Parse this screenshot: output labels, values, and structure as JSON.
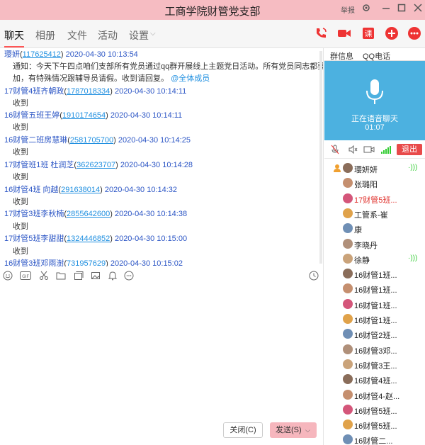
{
  "window": {
    "title": "工商学院财管党支部",
    "report_label": "举报",
    "controls": [
      "settings-icon",
      "minimize-icon",
      "maximize-icon",
      "close-icon"
    ]
  },
  "tabs": {
    "items": [
      "聊天",
      "相册",
      "文件",
      "活动",
      "设置"
    ],
    "active": "聊天"
  },
  "top_actions": [
    "voice-call-icon",
    "video-call-icon",
    "class-icon",
    "add-icon",
    "more-icon"
  ],
  "colors": {
    "title_bg": "#f6bcc2",
    "accent": "#f55555",
    "voice_panel": "#4cb1e0",
    "sender": "#2b55c5",
    "link": "#1f8fe0",
    "exit_red": "#e84a4a"
  },
  "messages": [
    {
      "sender": "璎妍",
      "qq": "117625412",
      "time": "2020-04-30 10:13:54",
      "body": "通知：今天下午四点咱们支部所有党员通过qq群开展线上主题党日活动。所有党员同志都要上线参",
      "body2": "加，有特殊情况跟辅导员请假。收到请回复。",
      "at": "@全体成员"
    },
    {
      "sender": "17财管4班齐朝政",
      "qq": "1787018334",
      "time": "2020-04-30 10:14:11",
      "body": "收到"
    },
    {
      "sender": "16财管五班王婷",
      "qq": "1910174654",
      "time": "2020-04-30 10:14:11",
      "body": "收到"
    },
    {
      "sender": "16财管二班房慧琳",
      "qq": "2581705700",
      "time": "2020-04-30 10:14:25",
      "body": "收到"
    },
    {
      "sender": "17财管班1班 杜润芝",
      "qq": "362623707",
      "time": "2020-04-30 10:14:28",
      "body": "收到"
    },
    {
      "sender": "16财管4班 向越",
      "qq": "291638014",
      "time": "2020-04-30 10:14:32",
      "body": "收到"
    },
    {
      "sender": "17财管3班李秋楠",
      "qq": "2855642600",
      "time": "2020-04-30 10:14:38",
      "body": "收到"
    },
    {
      "sender": "17财管5班李甜甜",
      "qq": "1324446852",
      "time": "2020-04-30 10:15:00",
      "body": "收到"
    },
    {
      "sender": "16财管3班邓雨澍",
      "qq": "731957629",
      "time": "2020-04-30 10:15:02",
      "body": ""
    }
  ],
  "toolbar": [
    "emoji-icon",
    "gif-icon",
    "scissors-icon",
    "folder-icon",
    "gallery-icon",
    "image-icon",
    "bell-icon",
    "more-icon",
    "history-icon"
  ],
  "buttons": {
    "close": "关闭(C)",
    "send": "发送(S)"
  },
  "right_tabs": [
    "群信息",
    "QQ电话"
  ],
  "voice": {
    "status": "正在语音聊天",
    "duration": "01:07",
    "exit": "退出"
  },
  "members": [
    {
      "name": "璎妍妍",
      "red": false,
      "speaking": true
    },
    {
      "name": "张璐阳",
      "red": false,
      "speaking": false
    },
    {
      "name": "17财管5班...",
      "red": true,
      "speaking": false
    },
    {
      "name": "工管系-崔",
      "red": false,
      "speaking": false
    },
    {
      "name": "康",
      "red": false,
      "speaking": false
    },
    {
      "name": "李晓丹",
      "red": false,
      "speaking": false
    },
    {
      "name": "徐静",
      "red": false,
      "speaking": true
    },
    {
      "name": "16财管1班...",
      "red": false,
      "speaking": false
    },
    {
      "name": "16财管1班...",
      "red": false,
      "speaking": false
    },
    {
      "name": "16财管1班...",
      "red": false,
      "speaking": false
    },
    {
      "name": "16财管1班...",
      "red": false,
      "speaking": false
    },
    {
      "name": "16财管2班...",
      "red": false,
      "speaking": false
    },
    {
      "name": "16财管3邓...",
      "red": false,
      "speaking": false
    },
    {
      "name": "16财管3王...",
      "red": false,
      "speaking": false
    },
    {
      "name": "16财管4班...",
      "red": false,
      "speaking": false
    },
    {
      "name": "16财管4-赵...",
      "red": false,
      "speaking": false
    },
    {
      "name": "16财管5班...",
      "red": false,
      "speaking": false
    },
    {
      "name": "16财管5班...",
      "red": false,
      "speaking": false
    },
    {
      "name": "16财管二...",
      "red": false,
      "speaking": false
    }
  ]
}
